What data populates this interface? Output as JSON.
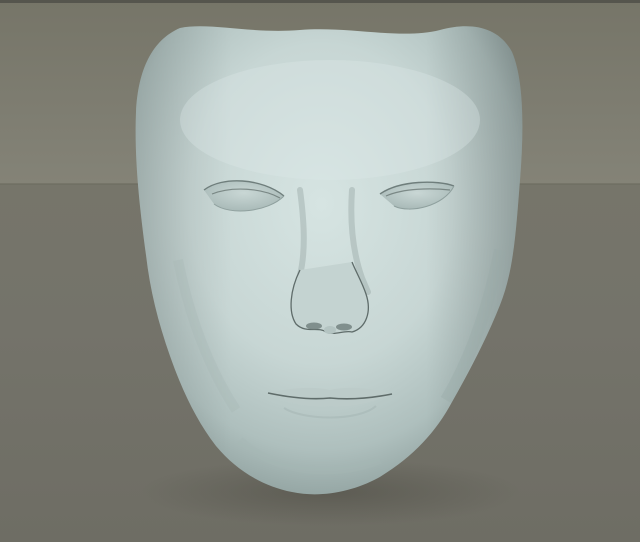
{
  "scene": {
    "subject": "mask-render",
    "colors": {
      "backdrop": "#7e7d71",
      "floor": "#74736a",
      "mask_light": "#d3e1df",
      "mask_mid": "#bccbc9",
      "mask_shadow": "#9fb0ae",
      "crease": "#5f6c6a"
    }
  }
}
